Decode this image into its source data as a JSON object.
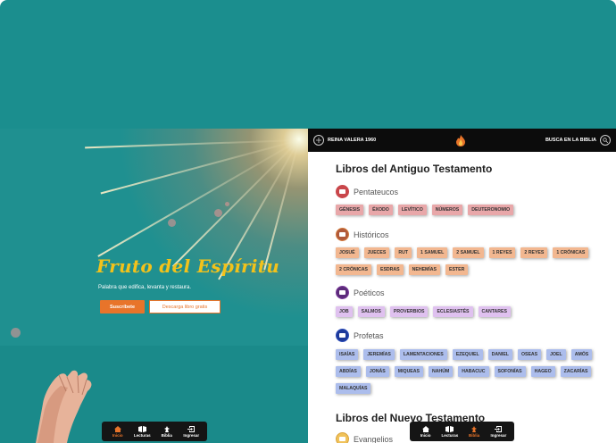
{
  "hero": {
    "title": "Fruto del Espíritu",
    "subtitle": "Palabra que edifica, levanta y restaura.",
    "subscribe_label": "Suscríbete",
    "download_label": "Descarga libro gratis"
  },
  "bottom_nav_left": {
    "items": [
      {
        "label": "Inicio",
        "icon": "home-icon",
        "active": true
      },
      {
        "label": "Lecturas",
        "icon": "book-open-icon",
        "active": false
      },
      {
        "label": "Biblia",
        "icon": "bible-icon",
        "active": false
      },
      {
        "label": "Ingresar",
        "icon": "login-icon",
        "active": false
      }
    ]
  },
  "bottom_nav_right": {
    "items": [
      {
        "label": "Inicio",
        "icon": "home-icon",
        "active": false
      },
      {
        "label": "Lecturas",
        "icon": "book-open-icon",
        "active": false
      },
      {
        "label": "Biblia",
        "icon": "bible-icon",
        "active": true
      },
      {
        "label": "Ingresar",
        "icon": "login-icon",
        "active": false
      }
    ]
  },
  "topbar": {
    "version_label": "REINA VALERA 1960",
    "search_label": "BUSCA EN LA BIBLIA",
    "logo_icon": "flame-logo-icon"
  },
  "old_testament": {
    "title": "Libros del Antiguo Testamento",
    "categories": [
      {
        "name": "Pentateucos",
        "color": "#c9464b",
        "books": [
          "GÉNESIS",
          "ÉXODO",
          "LEVÍTICO",
          "NÚMEROS",
          "DEUTERONOMIO"
        ]
      },
      {
        "name": "Históricos",
        "color": "#d27a3c",
        "books": [
          "JOSUÉ",
          "JUECES",
          "RUT",
          "1 SAMUEL",
          "2 SAMUEL",
          "1 REYES",
          "2 REYES",
          "1 CRÓNICAS",
          "2 CRÓNICAS",
          "ESDRAS",
          "NEHEMÍAS",
          "ESTER"
        ]
      },
      {
        "name": "Poéticos",
        "color": "#7a3b9a",
        "books": [
          "JOB",
          "SALMOS",
          "PROVERBIOS",
          "ECLESIASTÉS",
          "CANTARES"
        ]
      },
      {
        "name": "Profetas",
        "color": "#2a4bb8",
        "books": [
          "ISAÍAS",
          "JEREMÍAS",
          "LAMENTACIONES",
          "EZEQUIEL",
          "DANIEL",
          "OSEAS",
          "JOEL",
          "AMÓS",
          "ABDÍAS",
          "JONÁS",
          "MIQUEAS",
          "NAHÚM",
          "HABACUC",
          "SOFONÍAS",
          "HAGEO",
          "ZACARÍAS",
          "MALAQUÍAS"
        ]
      }
    ]
  },
  "new_testament": {
    "title": "Libros del Nuevo Testamento",
    "first_category": "Evangelios"
  },
  "colors": {
    "teal": "#1b8e8e",
    "accent_orange": "#e8742a",
    "title_gold": "#f2c21b"
  }
}
